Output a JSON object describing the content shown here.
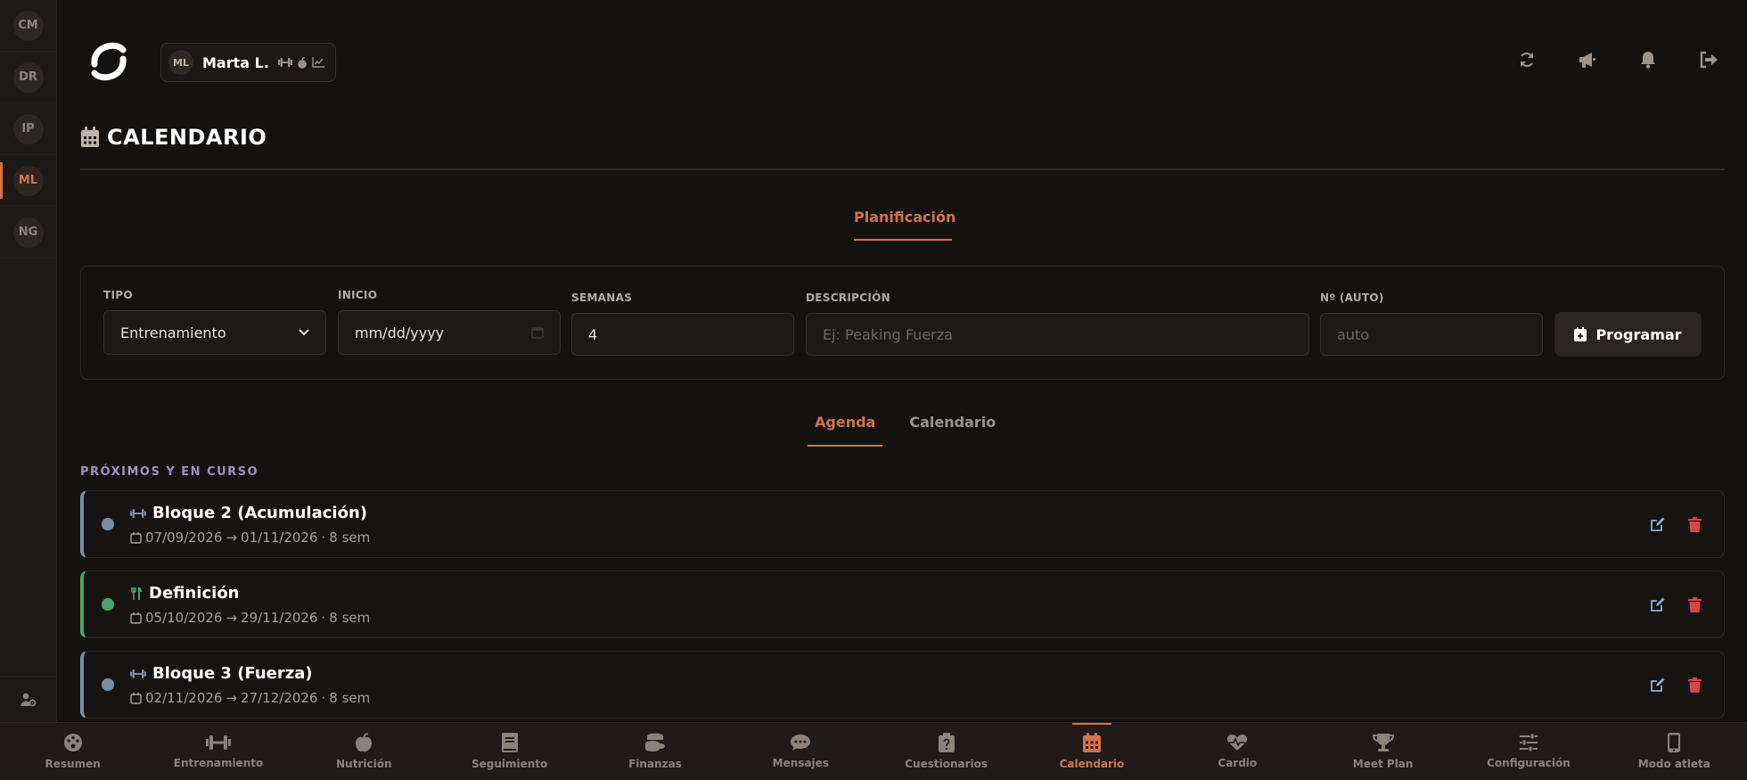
{
  "colors": {
    "accent": "#d2744a",
    "blue_block": "#7a8fa6",
    "green_block": "#4aa36b",
    "danger": "#d9434a",
    "edit": "#8aaed1"
  },
  "rail": {
    "clients": [
      "CM",
      "DR",
      "IP",
      "ML",
      "NG"
    ],
    "active": "ML"
  },
  "header": {
    "client_initials": "ML",
    "client_name": "Marta L.",
    "chip_icons": [
      "dumbbell-icon",
      "apple-icon",
      "chart-line-icon"
    ],
    "actions": [
      "refresh-icon",
      "megaphone-icon",
      "bell-icon",
      "logout-icon"
    ]
  },
  "page": {
    "title": "CALENDARIO"
  },
  "planning_tab": "Planificación",
  "form": {
    "tipo": {
      "label": "TIPO",
      "value": "Entrenamiento"
    },
    "inicio": {
      "label": "INICIO",
      "value": "mm/dd/yyyy"
    },
    "semanas": {
      "label": "SEMANAS",
      "value": "4"
    },
    "descripcion": {
      "label": "DESCRIPCIÓN",
      "placeholder": "Ej: Peaking Fuerza"
    },
    "numero": {
      "label": "Nº (AUTO)",
      "placeholder": "auto"
    },
    "submit": "Programar"
  },
  "subtabs": [
    "Agenda",
    "Calendario"
  ],
  "section_label": "PRÓXIMOS Y EN CURSO",
  "cards": [
    {
      "title": "Bloque 2 (Acumulación)",
      "start": "07/09/2026",
      "end": "01/11/2026",
      "weeks": "8 sem",
      "icon": "dumbbell-icon",
      "kind": "training"
    },
    {
      "title": "Definición",
      "start": "05/10/2026",
      "end": "29/11/2026",
      "weeks": "8 sem",
      "icon": "utensils-icon",
      "kind": "nutrition"
    },
    {
      "title": "Bloque 3 (Fuerza)",
      "start": "02/11/2026",
      "end": "27/12/2026",
      "weeks": "8 sem",
      "icon": "dumbbell-icon",
      "kind": "training"
    }
  ],
  "arrow": "→",
  "sep": "·",
  "nav": [
    {
      "label": "Resumen",
      "icon": "palette-icon"
    },
    {
      "label": "Entrenamiento",
      "icon": "dumbbell-icon"
    },
    {
      "label": "Nutrición",
      "icon": "apple-icon"
    },
    {
      "label": "Seguimiento",
      "icon": "book-icon"
    },
    {
      "label": "Finanzas",
      "icon": "coins-icon"
    },
    {
      "label": "Mensajes",
      "icon": "chat-icon"
    },
    {
      "label": "Cuestionarios",
      "icon": "clipboard-question-icon"
    },
    {
      "label": "Calendario",
      "icon": "calendar-icon",
      "active": true
    },
    {
      "label": "Cardio",
      "icon": "heart-pulse-icon"
    },
    {
      "label": "Meet Plan",
      "icon": "trophy-icon"
    },
    {
      "label": "Configuración",
      "icon": "sliders-icon"
    },
    {
      "label": "Modo atleta",
      "icon": "mobile-icon"
    }
  ]
}
